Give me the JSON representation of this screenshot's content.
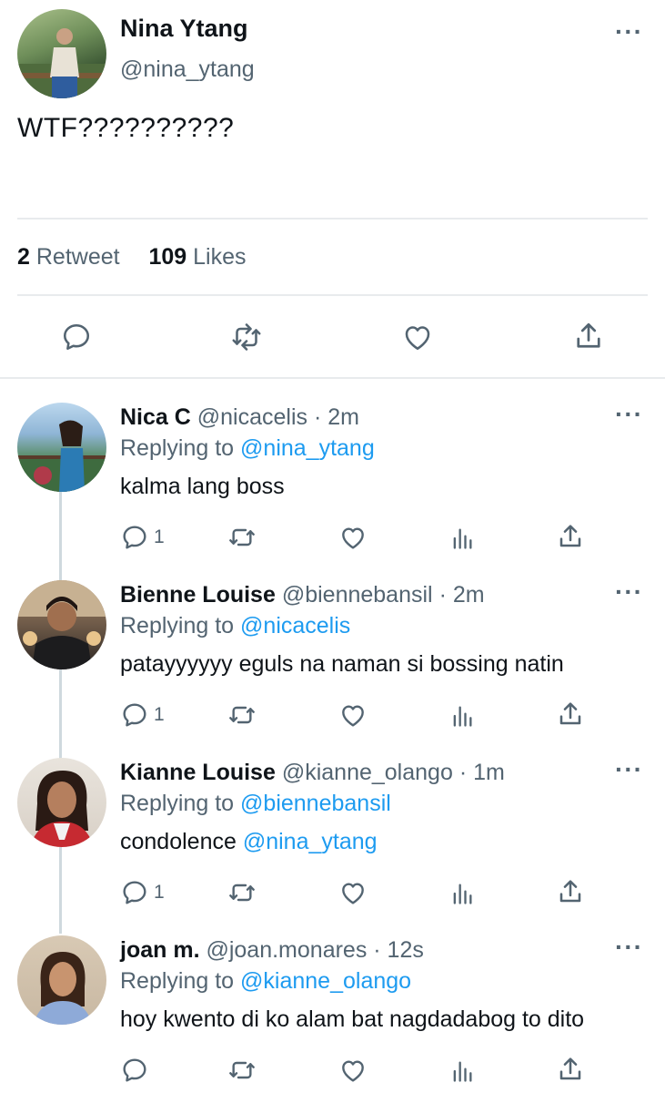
{
  "tweet": {
    "author_name": "Nina Ytang",
    "author_handle": "@nina_ytang",
    "text": "WTF??????????",
    "retweet_count": "2",
    "retweet_label": "Retweet",
    "likes_count": "109",
    "likes_label": "Likes"
  },
  "replies": [
    {
      "name": "Nica C",
      "handle": "@nicacelis",
      "time": "· 2m",
      "replying_label": "Replying to",
      "replying_to": "@nina_ytang",
      "text": "kalma lang boss",
      "mention": "",
      "reply_count": "1"
    },
    {
      "name": "Bienne Louise",
      "handle": "@biennebansil",
      "time": "· 2m",
      "replying_label": "Replying to",
      "replying_to": "@nicacelis",
      "text": "patayyyyyy eguls na naman si bossing natin",
      "mention": "",
      "reply_count": "1"
    },
    {
      "name": "Kianne Louise",
      "handle": "@kianne_olango",
      "time": "· 1m",
      "replying_label": "Replying to",
      "replying_to": "@biennebansil",
      "text": "condolence ",
      "mention": "@nina_ytang",
      "reply_count": "1"
    },
    {
      "name": "joan m.",
      "handle": "@joan.monares",
      "time": "· 12s",
      "replying_label": "Replying to",
      "replying_to": "@kianne_olango",
      "text": "hoy kwento di ko alam bat nagdadabog to dito",
      "mention": "",
      "reply_count": ""
    }
  ],
  "icons": {
    "more": "more-icon",
    "reply": "reply-icon",
    "retweet": "retweet-icon",
    "like": "heart-icon",
    "share": "share-icon",
    "analytics": "analytics-icon"
  },
  "colors": {
    "link": "#1d9bf0",
    "muted": "#536471",
    "text": "#0f1419",
    "divider": "#e8ebed"
  }
}
